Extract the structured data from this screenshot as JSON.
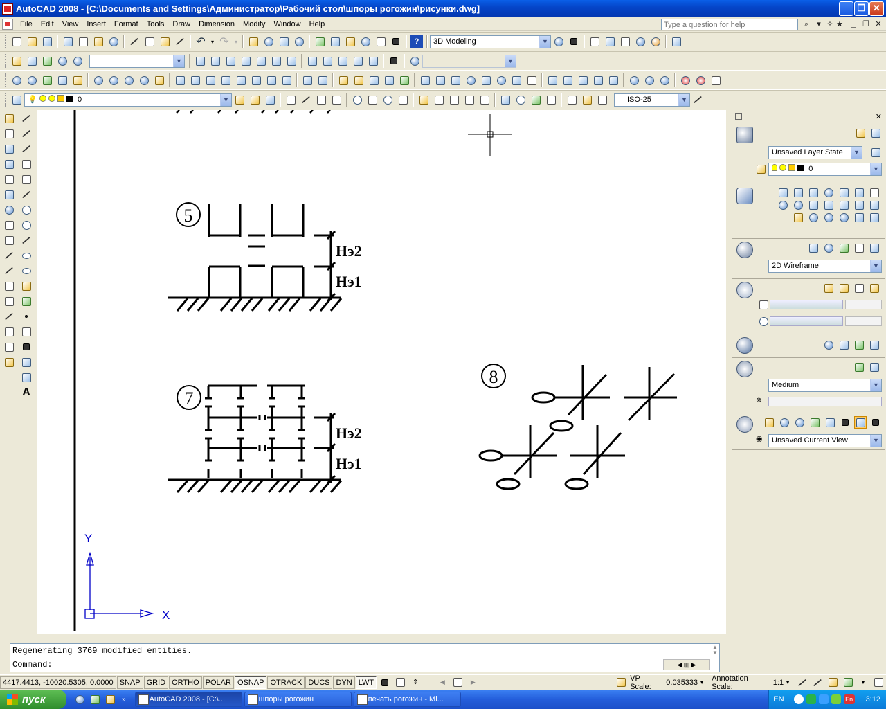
{
  "window": {
    "title": "AutoCAD 2008 - [C:\\Documents and Settings\\Администратор\\Рабочий стол\\шпоры рогожин\\рисунки.dwg]",
    "min": "_",
    "max": "❐",
    "close": "✕"
  },
  "menu": {
    "items": [
      "File",
      "Edit",
      "View",
      "Insert",
      "Format",
      "Tools",
      "Draw",
      "Dimension",
      "Modify",
      "Window",
      "Help"
    ],
    "help_placeholder": "Type a question for help",
    "doc_min": "_",
    "doc_restore": "❐",
    "doc_close": "✕"
  },
  "toolbars": {
    "workspace": "3D Modeling",
    "layer_name": "0",
    "dim_style": "ISO-25",
    "named_view": "",
    "other": ""
  },
  "drawing": {
    "fig5_label": "5",
    "fig7_label": "7",
    "fig8_label": "8",
    "h_e2": "Нэ2",
    "h_e1": "Нэ1",
    "ucs_y": "Y",
    "ucs_x": "X"
  },
  "panel": {
    "layer_state": "Unsaved Layer State",
    "layer_name": "0",
    "visual_style": "2D Wireframe",
    "render_quality": "Medium",
    "current_view": "Unsaved Current View"
  },
  "command": {
    "history": "Regenerating 3769 modified entities.",
    "prompt": "Command:"
  },
  "status": {
    "coords": "4417.4413, -10020.5305, 0.0000",
    "toggles": [
      {
        "label": "SNAP",
        "on": false
      },
      {
        "label": "GRID",
        "on": false
      },
      {
        "label": "ORTHO",
        "on": false
      },
      {
        "label": "POLAR",
        "on": false
      },
      {
        "label": "OSNAP",
        "on": true
      },
      {
        "label": "OTRACK",
        "on": false
      },
      {
        "label": "DUCS",
        "on": false
      },
      {
        "label": "DYN",
        "on": false
      },
      {
        "label": "LWT",
        "on": true
      }
    ],
    "vp_scale_label": "VP Scale:",
    "vp_scale_value": "0.035333",
    "annotation_label": "Annotation Scale:",
    "annotation_value": "1:1"
  },
  "taskbar": {
    "start": "пуск",
    "tasks": [
      "AutoCAD 2008 - [C:\\...",
      "шпоры рогожин",
      "печать рогожин - Mi..."
    ],
    "lang": "EN",
    "lang2": "En",
    "clock": "3:12"
  }
}
